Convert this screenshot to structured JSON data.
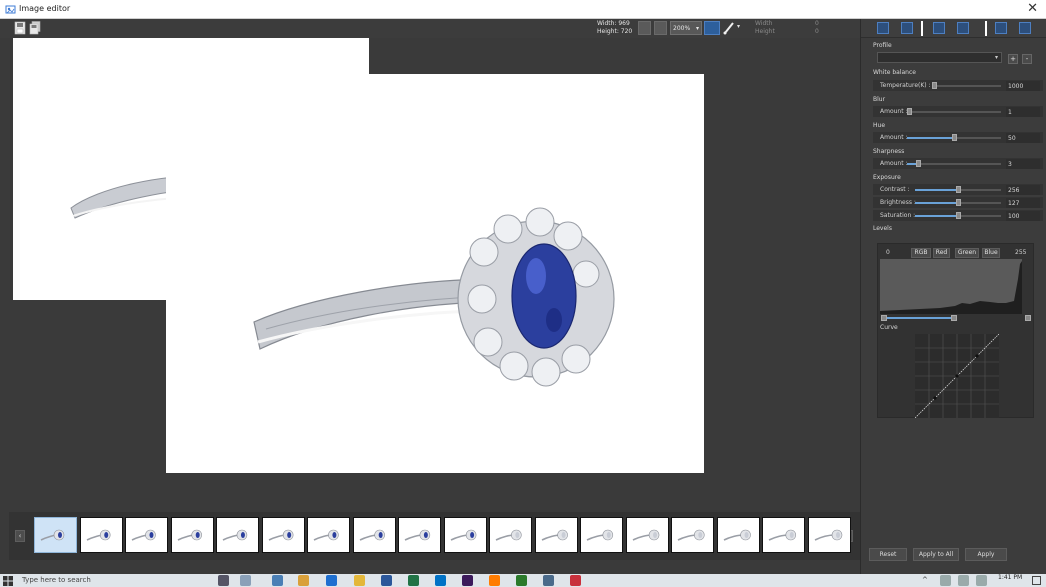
{
  "window": {
    "title": "Image editor",
    "close_glyph": "✕"
  },
  "toolbar": {
    "width_label": "Width: 969",
    "height_label": "Height: 720",
    "zoom": "200%",
    "zoom_caret": "▾",
    "dim_labels": [
      "Width",
      "Height"
    ],
    "dim_values": [
      "0",
      "0"
    ]
  },
  "panel": {
    "profile": {
      "heading": "Profile",
      "add": "+",
      "remove": "-",
      "caret": "▾"
    },
    "white_balance": {
      "heading": "White balance",
      "label": "Temperature(K) :",
      "value": "1000",
      "fraction": 0.02
    },
    "blur": {
      "heading": "Blur",
      "label": "Amount :",
      "value": "1",
      "fraction": 0.02
    },
    "hue": {
      "heading": "Hue",
      "label": "Amount :",
      "value": "50",
      "fraction": 0.5
    },
    "sharpness": {
      "heading": "Sharpness",
      "label": "Amount :",
      "value": "3",
      "fraction": 0.12
    },
    "exposure": {
      "heading": "Exposure",
      "rows": [
        {
          "label": "Contrast :",
          "value": "256",
          "fraction": 0.5
        },
        {
          "label": "Brightness :",
          "value": "127",
          "fraction": 0.5
        },
        {
          "label": "Saturation :",
          "value": "100",
          "fraction": 0.5
        }
      ]
    },
    "levels": {
      "heading": "Levels",
      "min": "0",
      "max": "255",
      "tabs": [
        "RGB",
        "Red",
        "Green",
        "Blue"
      ],
      "curve_label": "Curve"
    },
    "buttons": {
      "reset": "Reset",
      "apply_all": "Apply to All",
      "apply": "Apply"
    }
  },
  "filmstrip": {
    "prev": "‹",
    "next": "›",
    "thumb_count": 18,
    "selected_index": 0
  },
  "taskbar": {
    "search_placeholder": "Type here to search",
    "time": "1:41 PM"
  },
  "colors": {
    "accent": "#6aa2d8",
    "selected_thumb": "#cfe3f6",
    "sapphire": "#2b3f9e",
    "window_bg": "#3a3a3a"
  }
}
